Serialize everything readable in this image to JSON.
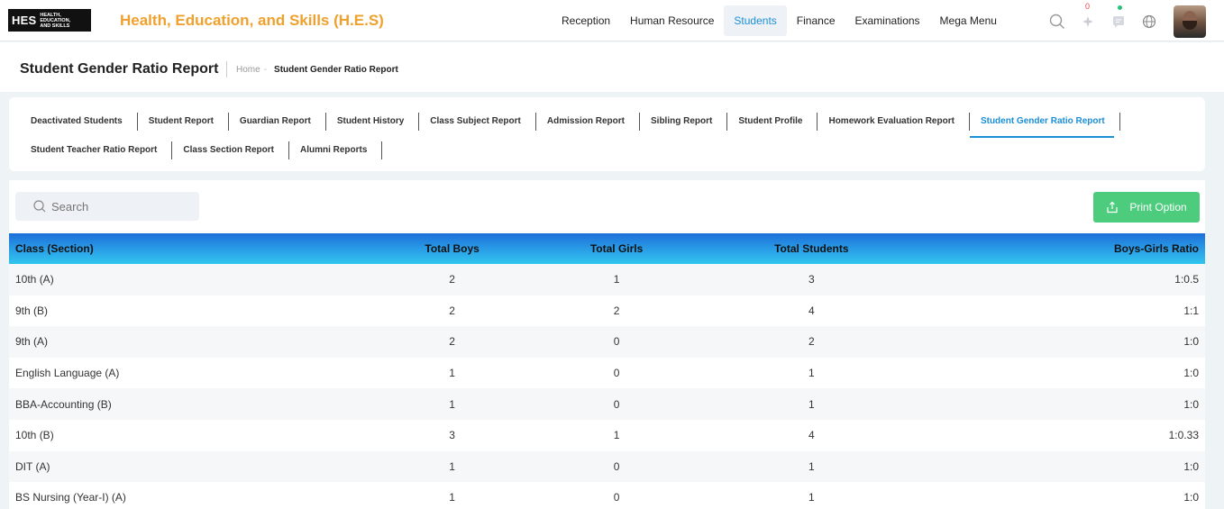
{
  "header": {
    "logo_text": "HES",
    "logo_sub": [
      "HEALTH,",
      "EDUCATION,",
      "AND SKILLS"
    ],
    "app_title": "Health, Education, and Skills (H.E.S)",
    "nav": [
      "Reception",
      "Human Resource",
      "Students",
      "Finance",
      "Examinations",
      "Mega Menu"
    ],
    "active_nav": "Students",
    "notification_count": "0",
    "icons": [
      "search-icon",
      "notification-icon",
      "chat-icon",
      "globe-icon",
      "user-avatar"
    ]
  },
  "page": {
    "title": "Student Gender Ratio Report",
    "breadcrumb_home": "Home",
    "breadcrumb_sep": "-",
    "breadcrumb_current": "Student Gender Ratio Report"
  },
  "tabs": {
    "row1": [
      "Deactivated Students",
      "Student Report",
      "Guardian Report",
      "Student History",
      "Class Subject Report",
      "Admission Report",
      "Sibling Report",
      "Student Profile",
      "Homework Evaluation Report",
      "Student Gender Ratio Report"
    ],
    "row2": [
      "Student Teacher Ratio Report",
      "Class Section Report",
      "Alumni Reports"
    ],
    "active": "Student Gender Ratio Report"
  },
  "toolbar": {
    "search_placeholder": "Search",
    "print_label": "Print Option"
  },
  "colors": {
    "accent": "#1b8fd6",
    "brand": "#f0a02c",
    "print": "#4ccc7c"
  },
  "table": {
    "headers": [
      "Class (Section)",
      "Total Boys",
      "Total Girls",
      "Total Students",
      "Boys-Girls Ratio"
    ],
    "rows": [
      [
        "10th (A)",
        "2",
        "1",
        "3",
        "1:0.5"
      ],
      [
        "9th (B)",
        "2",
        "2",
        "4",
        "1:1"
      ],
      [
        "9th (A)",
        "2",
        "0",
        "2",
        "1:0"
      ],
      [
        "English Language (A)",
        "1",
        "0",
        "1",
        "1:0"
      ],
      [
        "BBA-Accounting (B)",
        "1",
        "0",
        "1",
        "1:0"
      ],
      [
        "10th (B)",
        "3",
        "1",
        "4",
        "1:0.33"
      ],
      [
        "DIT (A)",
        "1",
        "0",
        "1",
        "1:0"
      ],
      [
        "BS Nursing (Year-I) (A)",
        "1",
        "0",
        "1",
        "1:0"
      ]
    ]
  }
}
